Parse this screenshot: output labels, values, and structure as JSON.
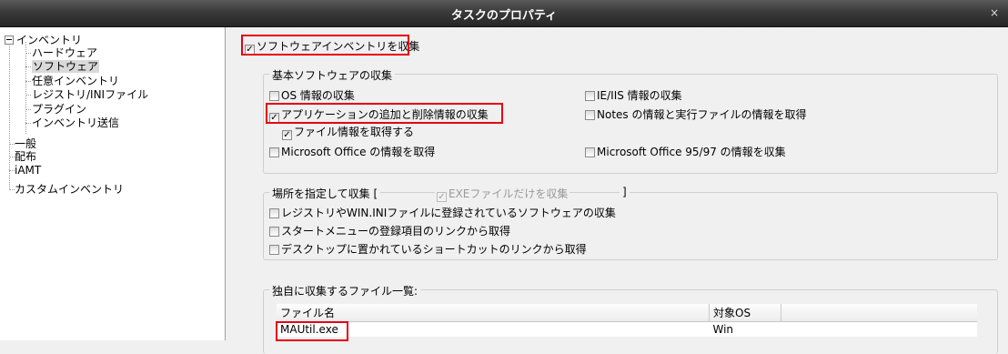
{
  "window": {
    "title": "タスクのプロパティ",
    "close": "×"
  },
  "tree": {
    "root": "インベントリ",
    "children": [
      "ハードウェア",
      "ソフトウェア",
      "任意インベントリ",
      "レジストリ/INIファイル",
      "プラグイン",
      "インベントリ送信"
    ],
    "siblings": [
      "一般",
      "配布",
      "iAMT",
      "カスタムインベントリ"
    ],
    "selected": "ソフトウェア"
  },
  "main": {
    "collect_software": {
      "label": "ソフトウェアインベントリを収集",
      "checked": true
    },
    "basic": {
      "title": "基本ソフトウェアの収集",
      "os_info": "OS 情報の収集",
      "ie_iis": "IE/IIS 情報の収集",
      "app_addremove": "アプリケーションの追加と削除情報の収集",
      "notes": "Notes の情報と実行ファイルの情報を取得",
      "file_info": "ファイル情報を取得する",
      "office": "Microsoft Office の情報を取得",
      "office9597": "Microsoft Office 95/97 の情報を収集"
    },
    "location": {
      "title": "場所を指定して収集 [",
      "title_close": "]",
      "exe_only": "EXEファイルだけを収集",
      "registry_win_ini": "レジストリやWIN.INIファイルに登録されているソフトウェアの収集",
      "start_menu": "スタートメニューの登録項目のリンクから取得",
      "desktop": "デスクトップに置かれているショートカットのリンクから取得"
    },
    "files": {
      "title": "独自に収集するファイル一覧:",
      "columns": [
        "ファイル名",
        "対象OS"
      ],
      "rows": [
        {
          "name": "MAUtil.exe",
          "os": "Win"
        }
      ]
    }
  },
  "checkmark": "✓",
  "colors": {
    "highlight": "#e60012",
    "titlebar": "#3a3a3a"
  }
}
